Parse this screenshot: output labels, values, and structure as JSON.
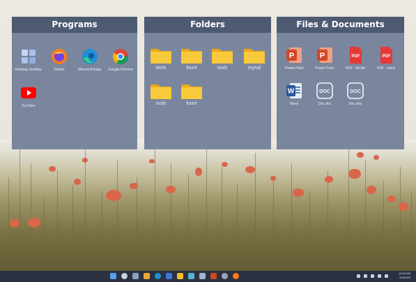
{
  "panels": [
    {
      "title": "Programs",
      "items": [
        {
          "label": "Desktop Desktop",
          "icon": "windows-start-icon"
        },
        {
          "label": "Firefox",
          "icon": "firefox-icon"
        },
        {
          "label": "Microsoft Edge",
          "icon": "edge-icon"
        },
        {
          "label": "Google Chrome",
          "icon": "chrome-icon"
        },
        {
          "label": "YouTube",
          "icon": "youtube-icon"
        }
      ]
    },
    {
      "title": "Folders",
      "items": [
        {
          "label": "tools",
          "icon": "folder-icon"
        },
        {
          "label": "fount",
          "icon": "folder-icon"
        },
        {
          "label": "tools",
          "icon": "folder-icon"
        },
        {
          "label": "mysql",
          "icon": "folder-icon"
        },
        {
          "label": "tools",
          "icon": "folder-icon"
        },
        {
          "label": "fount",
          "icon": "folder-icon"
        }
      ]
    },
    {
      "title": "Files & Documents",
      "items": [
        {
          "label": "Power Point",
          "icon": "powerpoint-icon"
        },
        {
          "label": "Power Point",
          "icon": "powerpoint-icon"
        },
        {
          "label": "PDF - file.file",
          "icon": "pdf-icon"
        },
        {
          "label": "PDF - stack",
          "icon": "pdf-icon"
        },
        {
          "label": "Word",
          "icon": "word-icon"
        },
        {
          "label": "Doc.doc",
          "icon": "doc-icon"
        },
        {
          "label": "Doc.doc",
          "icon": "doc-icon"
        }
      ]
    }
  ],
  "icon_text": {
    "powerpoint": "P",
    "word": "W",
    "pdf": "PDF",
    "doc": "DOC"
  },
  "taskbar": {
    "time": "10:00 AM",
    "date": "5/4/2023"
  },
  "colors": {
    "panel_body": "#7a869e",
    "panel_header": "#4e5a72",
    "taskbar": "#2b3140",
    "folder": "#f3bd2e",
    "flower": "#d9664a"
  }
}
